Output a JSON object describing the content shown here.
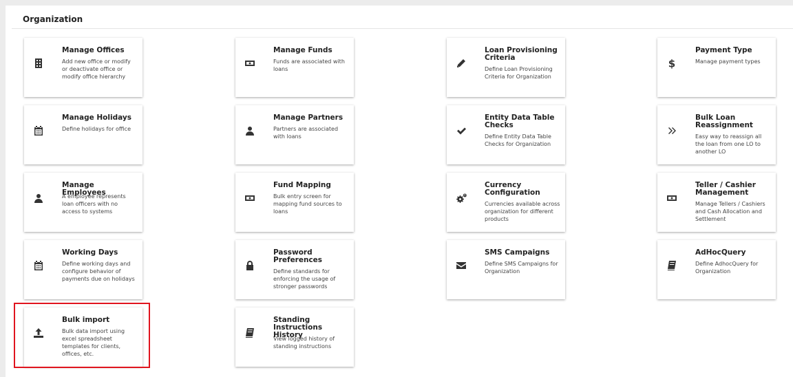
{
  "section": {
    "title": "Organization"
  },
  "colors": {
    "highlight": "#e0141e",
    "icon": "#333333"
  },
  "cards": [
    {
      "title": "Manage Offices",
      "desc": "Add new office or modify or deactivate office or modify office hierarchy",
      "icon": "building-icon"
    },
    {
      "title": "Manage Funds",
      "desc": "Funds are associated with loans",
      "icon": "money-icon"
    },
    {
      "title": "Loan Provisioning Criteria",
      "desc": "Define Loan Provisioning Criteria for Organization",
      "icon": "pencil-icon"
    },
    {
      "title": "Payment Type",
      "desc": "Manage payment types",
      "icon": "dollar-icon"
    },
    {
      "title": "Manage Holidays",
      "desc": "Define holidays for office",
      "icon": "calendar-icon"
    },
    {
      "title": "Manage Partners",
      "desc": "Partners are associated with loans",
      "icon": "user-icon"
    },
    {
      "title": "Entity Data Table Checks",
      "desc": "Define Entity Data Table Checks for Organization",
      "icon": "check-icon"
    },
    {
      "title": "Bulk Loan Reassignment",
      "desc": "Easy way to reassign all the loan from one LO to another LO",
      "icon": "double-chevron-right-icon"
    },
    {
      "title": "Manage Employees",
      "desc": "A employee represents loan officers with no access to systems",
      "icon": "user-icon"
    },
    {
      "title": "Fund Mapping",
      "desc": "Bulk entry screen for mapping fund sources to loans",
      "icon": "money-icon"
    },
    {
      "title": "Currency Configuration",
      "desc": "Currencies available across organization for different products",
      "icon": "gears-icon"
    },
    {
      "title": "Teller / Cashier Management",
      "desc": "Manage Tellers / Cashiers and Cash Allocation and Settlement",
      "icon": "money-icon"
    },
    {
      "title": "Working Days",
      "desc": "Define working days and configure behavior of payments due on holidays",
      "icon": "calendar-icon"
    },
    {
      "title": "Password Preferences",
      "desc": "Define standards for enforcing the usage of stronger passwords",
      "icon": "lock-icon"
    },
    {
      "title": "SMS Campaigns",
      "desc": "Define SMS Campaigns for Organization",
      "icon": "envelope-icon"
    },
    {
      "title": "AdHocQuery",
      "desc": "Define AdhocQuery for Organization",
      "icon": "book-icon"
    },
    {
      "title": "Bulk import",
      "desc": "Bulk data import using excel spreadsheet templates for clients, offices, etc.",
      "icon": "upload-icon"
    },
    {
      "title": "Standing Instructions History",
      "desc": "View logged history of standing instructions",
      "icon": "book-icon"
    }
  ]
}
